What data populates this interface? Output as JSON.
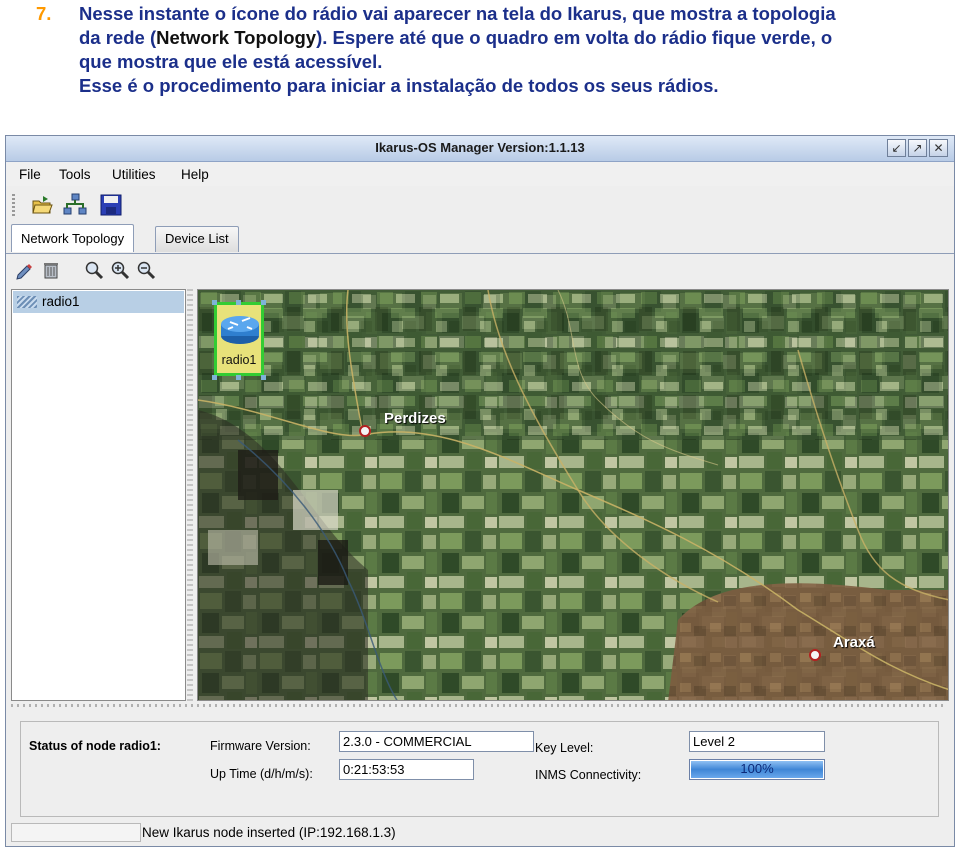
{
  "instructions": {
    "number": "7.",
    "line1": "Nesse instante o ícone do rádio vai aparecer na tela do Ikarus, que mostra a topologia",
    "line2_a": "da rede (",
    "line2_b": "Network Topology",
    "line2_c": "). Espere até que o quadro em volta do rádio fique verde, o",
    "line3": "que mostra que ele está acessível.",
    "line4": "Esse é o procedimento para iniciar a instalação de todos os seus rádios."
  },
  "window": {
    "title": "Ikarus-OS Manager   Version:1.1.13",
    "buttons": {
      "minimize": "↙",
      "maximize": "↗",
      "close": "✕"
    }
  },
  "menu": {
    "items": [
      "File",
      "Tools",
      "Utilities",
      "Help"
    ]
  },
  "toolbar": {
    "icons": [
      "open-folder-icon",
      "network-icon",
      "save-icon"
    ]
  },
  "tabs": [
    {
      "label": "Network Topology",
      "active": true
    },
    {
      "label": "Device List",
      "active": false
    }
  ],
  "topology_toolbar": {
    "icons": [
      "edit-icon",
      "delete-icon",
      "zoom-icon",
      "zoom-in-icon",
      "zoom-out-icon"
    ]
  },
  "tree": {
    "items": [
      "radio1"
    ]
  },
  "map": {
    "places": [
      "Perdizes",
      "Araxá"
    ],
    "node": {
      "label": "radio1",
      "status_color": "#33cc33"
    }
  },
  "status": {
    "heading": "Status of node radio1:",
    "firmware_label": "Firmware Version:",
    "firmware_value": "2.3.0 - COMMERCIAL",
    "uptime_label": "Up Time (d/h/m/s):",
    "uptime_value": "0:21:53:53",
    "keylevel_label": "Key Level:",
    "keylevel_value": "Level 2",
    "inms_label": "INMS Connectivity:",
    "inms_value": "100%",
    "inms_fraction": 1.0
  },
  "statusbar": {
    "message": "New Ikarus node inserted (IP:192.168.1.3)"
  },
  "colors": {
    "instruction_text": "#1b2f8a",
    "instruction_number": "#ff9900",
    "node_ok": "#33cc33",
    "selection": "#b8cfe5"
  }
}
